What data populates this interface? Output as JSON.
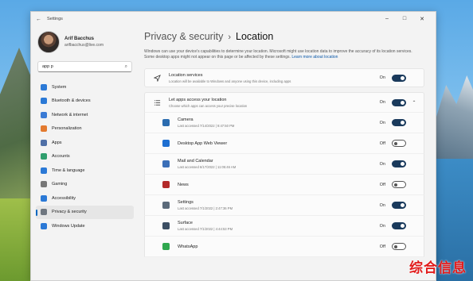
{
  "window": {
    "title": "Settings"
  },
  "profile": {
    "name": "Arif Bacchus",
    "email": "arifbacchus@live.com"
  },
  "search": {
    "value": "app p"
  },
  "sidebar": {
    "items": [
      {
        "label": "System",
        "icon": "monitor-icon",
        "color": "#2b79d6"
      },
      {
        "label": "Bluetooth & devices",
        "icon": "bluetooth-icon",
        "color": "#2b79d6"
      },
      {
        "label": "Network & internet",
        "icon": "wifi-icon",
        "color": "#3a7bd5"
      },
      {
        "label": "Personalization",
        "icon": "brush-icon",
        "color": "#e37a2f"
      },
      {
        "label": "Apps",
        "icon": "apps-icon",
        "color": "#4f6fa6"
      },
      {
        "label": "Accounts",
        "icon": "person-icon",
        "color": "#2f9e6d"
      },
      {
        "label": "Time & language",
        "icon": "globe-clock-icon",
        "color": "#2b79d6"
      },
      {
        "label": "Gaming",
        "icon": "gamepad-icon",
        "color": "#777777"
      },
      {
        "label": "Accessibility",
        "icon": "accessibility-icon",
        "color": "#2b79d6"
      },
      {
        "label": "Privacy & security",
        "icon": "shield-icon",
        "color": "#6f7780"
      },
      {
        "label": "Windows Update",
        "icon": "update-icon",
        "color": "#2b79d6"
      }
    ]
  },
  "main": {
    "breadcrumb_parent": "Privacy & security",
    "breadcrumb_sep": "›",
    "breadcrumb_current": "Location",
    "description": "Windows can use your device's capabilities to determine your location. Microsoft might use location data to improve the accuracy of its location services. Some desktop apps might not appear on this page or be affected by these settings.",
    "learn_more": "Learn more about location",
    "location_services": {
      "title": "Location services",
      "subtitle": "Location will be available to Windows and anyone using this device, including apps",
      "state": "On"
    },
    "let_apps": {
      "title": "Let apps access your location",
      "subtitle": "Choose which apps can access your precise location",
      "state": "On"
    },
    "apps": [
      {
        "name": "Camera",
        "sub": "Last accessed 7/14/2022  |  9:47:50 PM",
        "state": "On",
        "color": "#2b6cb0"
      },
      {
        "name": "Desktop App Web Viewer",
        "sub": "",
        "state": "Off",
        "color": "#1e6fd1"
      },
      {
        "name": "Mail and Calendar",
        "sub": "Last accessed 6/17/2022  |  11:05:46 AM",
        "state": "On",
        "color": "#3b6fb8"
      },
      {
        "name": "News",
        "sub": "",
        "state": "Off",
        "color": "#b32a2a"
      },
      {
        "name": "Settings",
        "sub": "Last accessed 7/1/2022  |  2:47:36 PM",
        "state": "On",
        "color": "#5b6a7a"
      },
      {
        "name": "Surface",
        "sub": "Last accessed 7/1/2022  |  4:44:53 PM",
        "state": "On",
        "color": "#3b4e63"
      },
      {
        "name": "WhatsApp",
        "sub": "",
        "state": "Off",
        "color": "#2fa84f"
      }
    ]
  },
  "watermark": "综合信息"
}
